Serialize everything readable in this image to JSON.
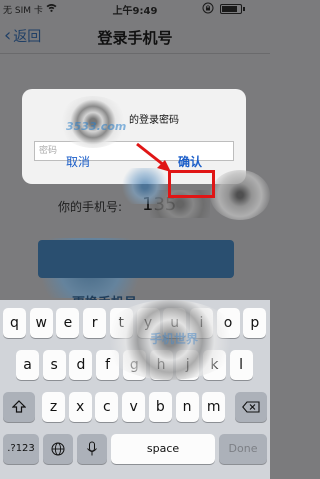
{
  "status_bar": {
    "carrier": "无 SIM 卡",
    "wifi_icon": "wifi-icon",
    "time": "上午9:49",
    "lock_icon": "orientation-lock-icon"
  },
  "navbar": {
    "back_label": "返回",
    "title": "登录手机号"
  },
  "page": {
    "phone_label": "你的手机号:",
    "phone_value": "135",
    "change_button_label": "更换手机号"
  },
  "dialog": {
    "message": "的登录密码",
    "password_placeholder": "密码",
    "cancel_label": "取消",
    "confirm_label": "确认"
  },
  "watermark": {
    "text": "3533.com",
    "keyboard_text": "手机世界"
  },
  "keyboard": {
    "row1": [
      "q",
      "w",
      "e",
      "r",
      "t",
      "y",
      "u",
      "i",
      "o",
      "p"
    ],
    "row2": [
      "a",
      "s",
      "d",
      "f",
      "g",
      "h",
      "j",
      "k",
      "l"
    ],
    "row3": [
      "z",
      "x",
      "c",
      "v",
      "b",
      "n",
      "m"
    ],
    "shift_icon": "shift-icon",
    "delete_icon": "backspace-icon",
    "numbers_label": ".?123",
    "globe_icon": "globe-icon",
    "mic_icon": "microphone-icon",
    "space_label": "space",
    "done_label": "Done"
  },
  "colors": {
    "accent": "#1b5ec9",
    "highlight": "#e01515"
  }
}
